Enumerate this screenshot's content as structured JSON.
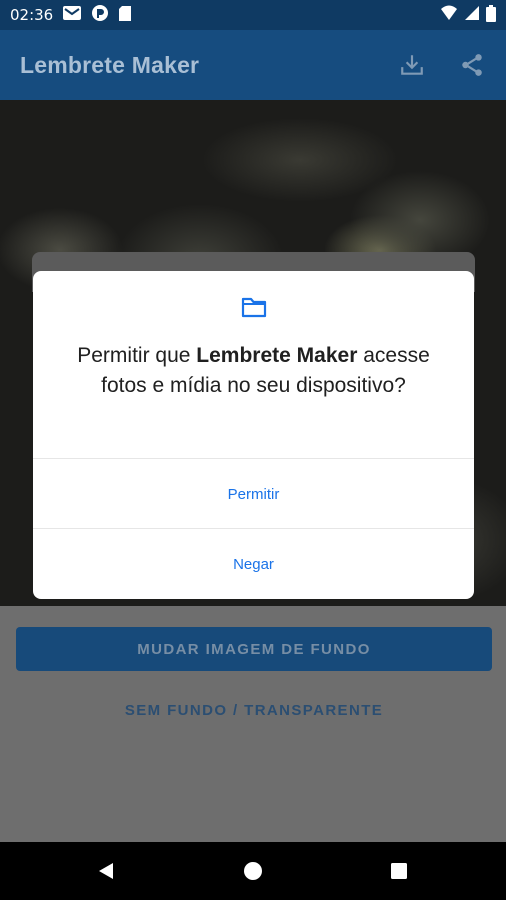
{
  "status_bar": {
    "time": "02:36",
    "icons": [
      "gmail-icon",
      "pocket-casts-icon",
      "sd-card-icon",
      "wifi-icon",
      "signal-icon",
      "battery-icon"
    ]
  },
  "app_bar": {
    "title": "Lembrete Maker",
    "actions": [
      "download-icon",
      "share-icon"
    ]
  },
  "panel": {
    "change_background_label": "MUDAR IMAGEM DE FUNDO",
    "no_background_label": "SEM FUNDO / TRANSPARENTE"
  },
  "dialog": {
    "icon": "folder-icon",
    "message_prefix": "Permitir que ",
    "app_name": "Lembrete Maker",
    "message_suffix": " acesse fotos e mídia no seu dispositivo?",
    "allow_label": "Permitir",
    "deny_label": "Negar"
  },
  "nav_bar": {
    "buttons": [
      "back-icon",
      "home-icon",
      "recents-icon"
    ]
  },
  "colors": {
    "app_bar": "#164c7f",
    "status_bar": "#0f3a63",
    "dialog_accent": "#1a73e8",
    "panel": "#6e6e6e"
  }
}
